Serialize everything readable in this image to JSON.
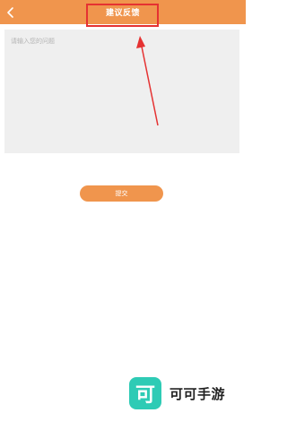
{
  "header": {
    "title": "建议反馈",
    "back_icon": "chevron-left-icon",
    "background_color": "#f0954d"
  },
  "feedback": {
    "placeholder": "请输入您的问题",
    "value": ""
  },
  "submit": {
    "label": "提交"
  },
  "watermark": {
    "logo_char": "可",
    "brand_name": "可可手游",
    "logo_color": "#2ecbb5"
  },
  "annotation": {
    "box_color": "#e53232",
    "arrow_color": "#e53232"
  }
}
